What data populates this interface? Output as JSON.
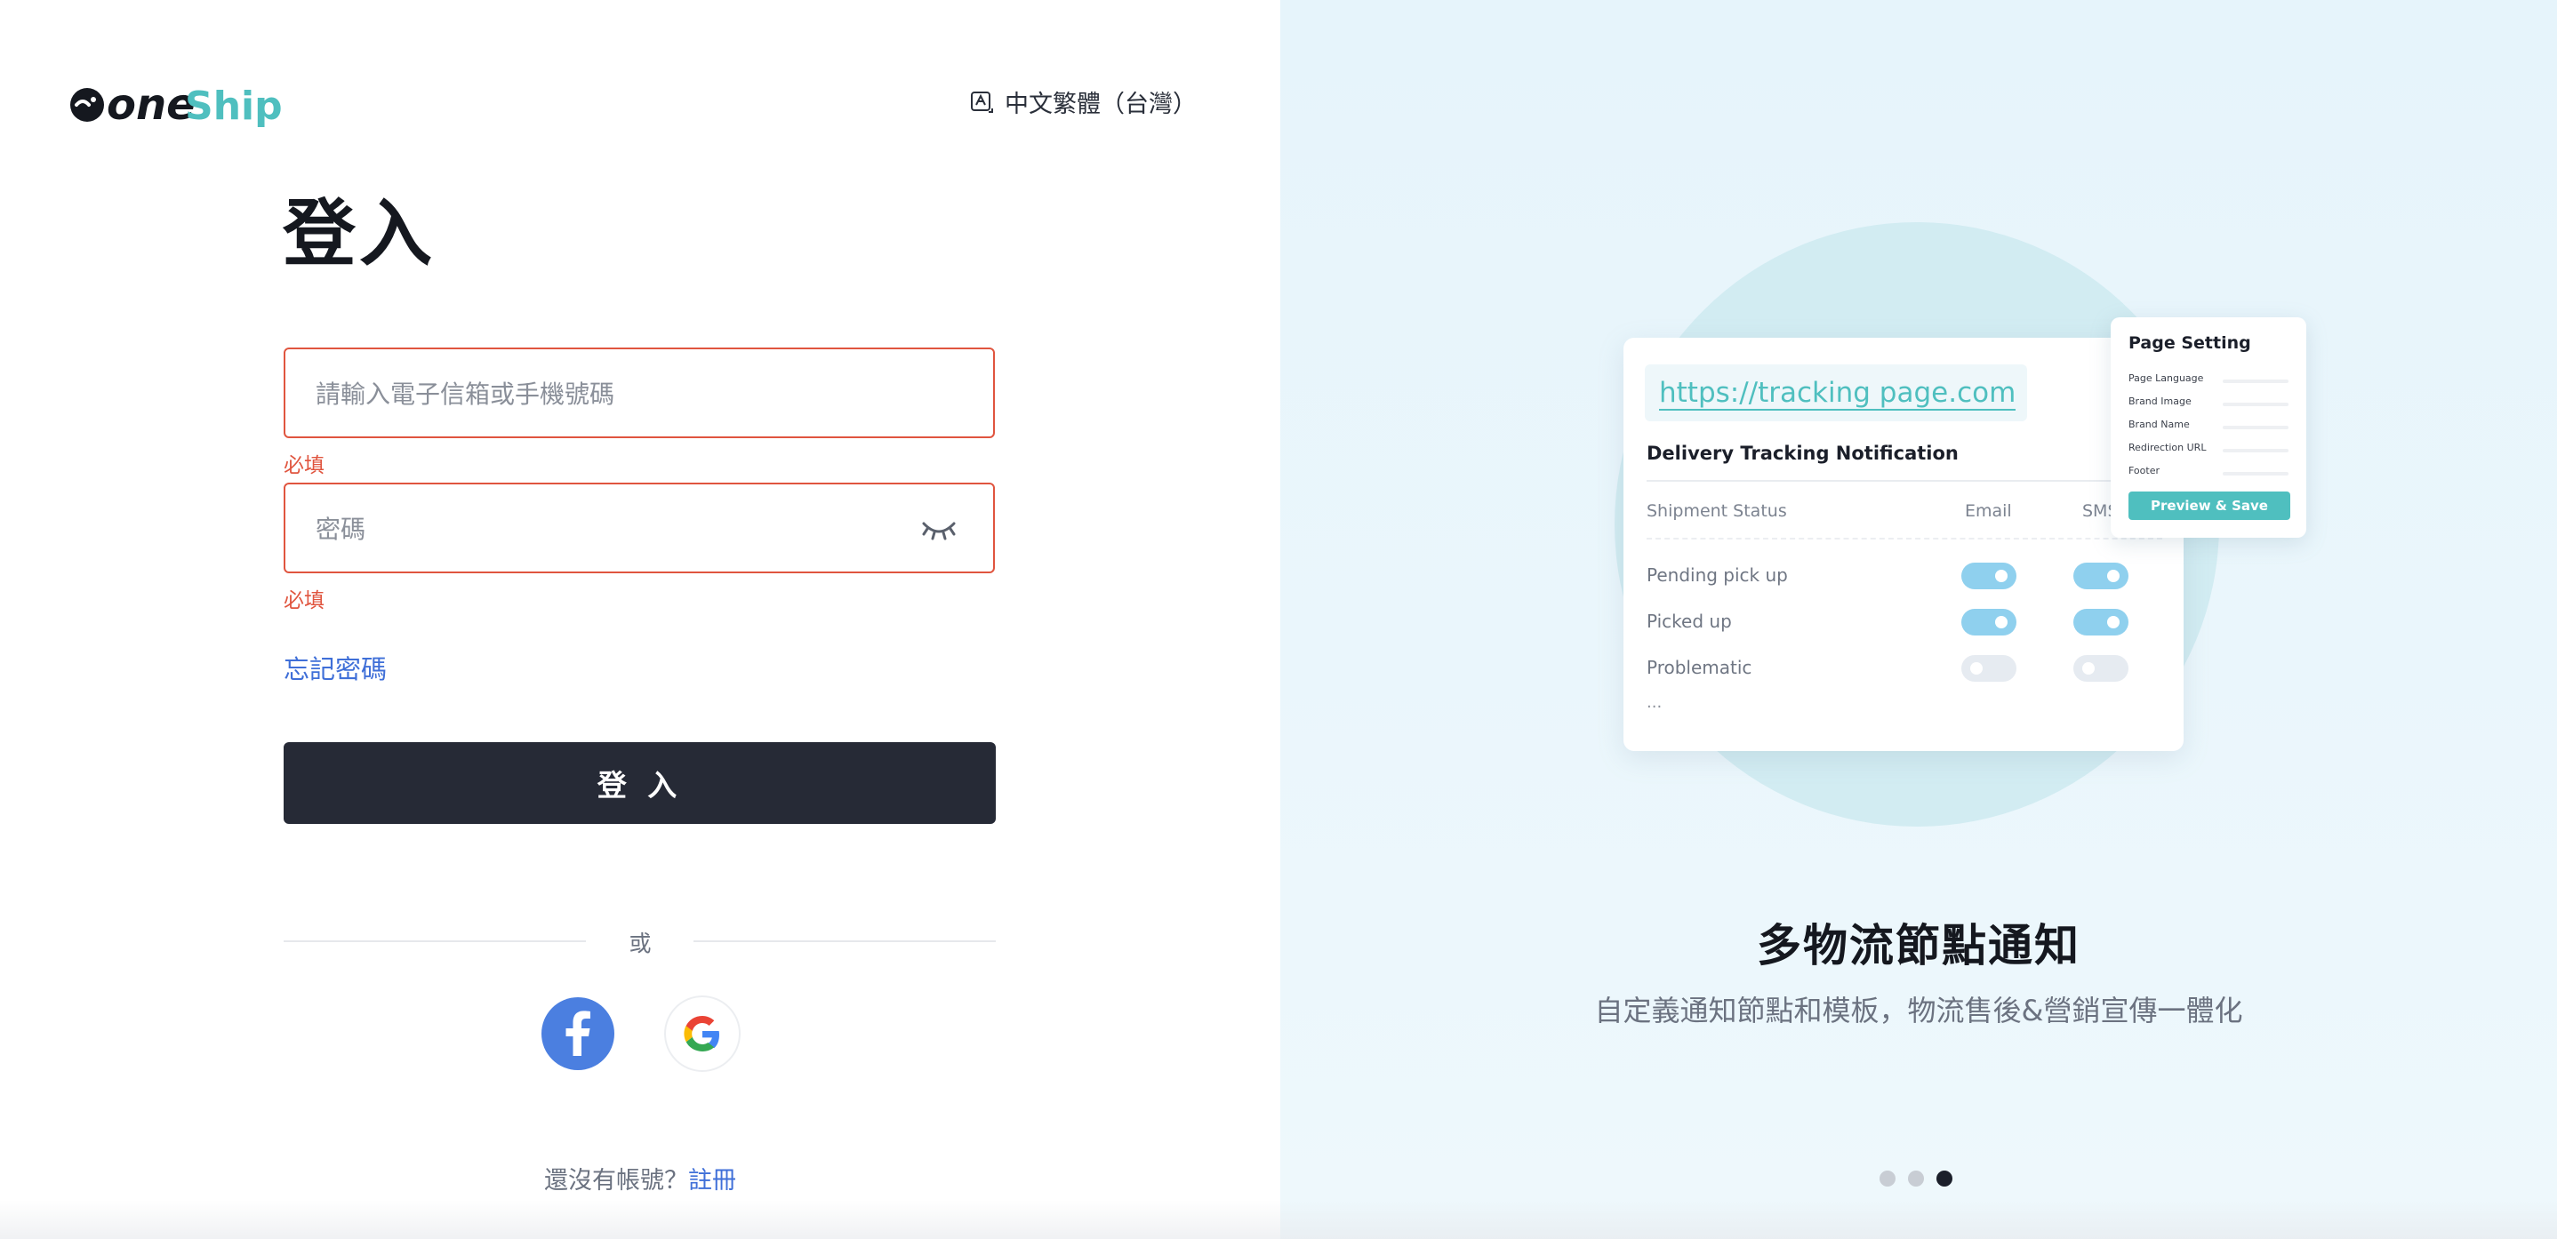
{
  "brand": {
    "logo_text_one": "one",
    "logo_text_ship": "Ship",
    "colors": {
      "dark": "#15181f",
      "teal": "#4fbfbf",
      "accent_blue": "#3f6fd8",
      "error": "#e0553f"
    }
  },
  "language": {
    "icon": "translate-icon",
    "label": "中文繁體（台灣）"
  },
  "login": {
    "title": "登入",
    "email": {
      "placeholder": "請輸入電子信箱或手機號碼",
      "value": "",
      "error": "必填"
    },
    "password": {
      "placeholder": "密碼",
      "value": "",
      "error": "必填",
      "visibility_icon": "eye-closed-icon"
    },
    "forgot_password": "忘記密碼",
    "submit_label": "登 入",
    "or_label": "或",
    "social": [
      {
        "name": "Facebook",
        "icon": "facebook-icon"
      },
      {
        "name": "Google",
        "icon": "google-icon"
      }
    ],
    "signup_prompt": "還沒有帳號？",
    "signup_link": "註冊"
  },
  "carousel": {
    "illustration": {
      "url": "https://tracking page.com",
      "card_title": "Delivery Tracking Notification",
      "columns": [
        "Shipment Status",
        "Email",
        "SMS"
      ],
      "rows": [
        {
          "label": "Pending pick up",
          "email": true,
          "sms": true
        },
        {
          "label": "Picked up",
          "email": true,
          "sms": true
        },
        {
          "label": "Problematic",
          "email": false,
          "sms": false
        }
      ],
      "ellipsis": "...",
      "page_setting": {
        "title": "Page Setting",
        "items": [
          "Page Language",
          "Brand Image",
          "Brand Name",
          "Redirection URL",
          "Footer"
        ],
        "button": "Preview & Save"
      }
    },
    "title": "多物流節點通知",
    "subtitle": "自定義通知節點和模板，物流售後&營銷宣傳一體化",
    "slide_count": 3,
    "active_index": 2
  }
}
